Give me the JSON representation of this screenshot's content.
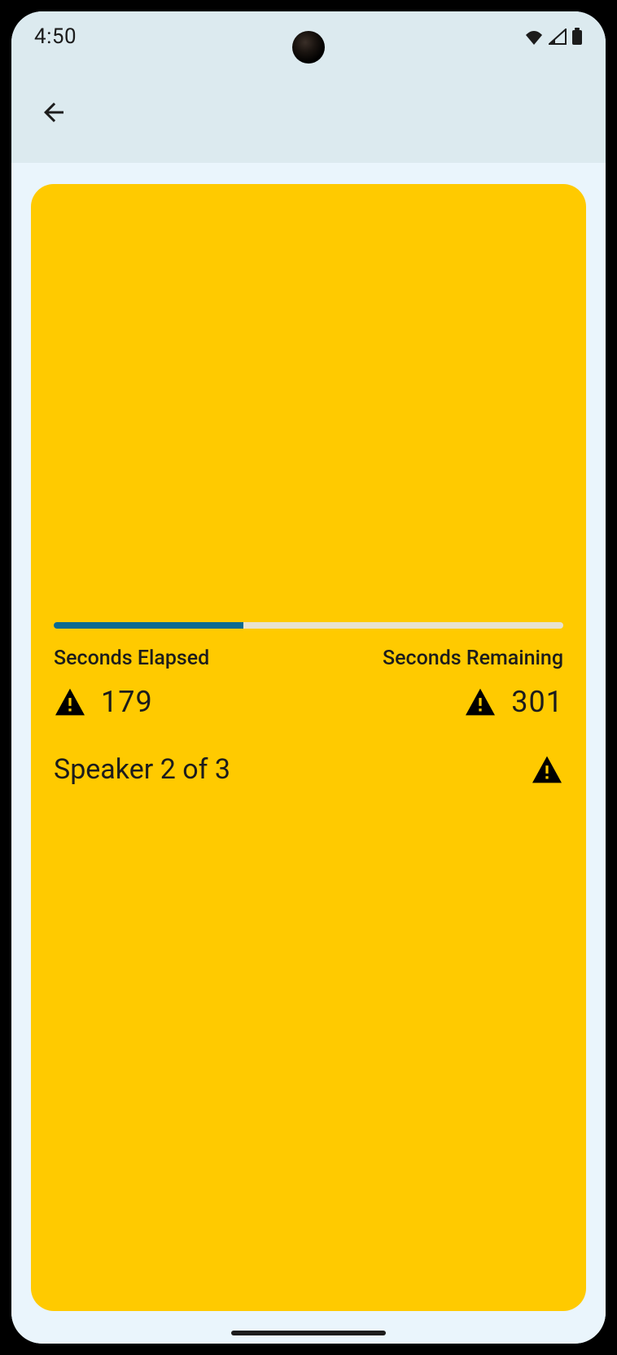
{
  "status": {
    "time": "4:50"
  },
  "timer": {
    "elapsed_label": "Seconds Elapsed",
    "remaining_label": "Seconds Remaining",
    "elapsed_value": "179",
    "remaining_value": "301",
    "progress_percent": 37.3,
    "speaker_text": "Speaker 2 of 3"
  },
  "colors": {
    "card_bg": "#ffca00",
    "progress_fill": "#0a6a8f",
    "screen_bg": "#eaf5fc",
    "header_bg": "#dceaef"
  }
}
